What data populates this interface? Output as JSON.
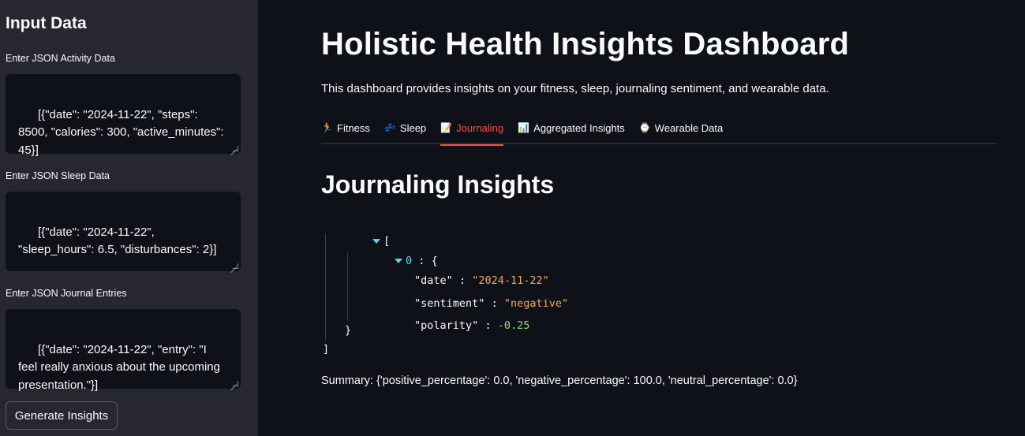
{
  "sidebar": {
    "title": "Input Data",
    "fields": [
      {
        "label": "Enter JSON Activity Data",
        "value": "[{\"date\": \"2024-11-22\", \"steps\": 8500, \"calories\": 300, \"active_minutes\": 45}]"
      },
      {
        "label": "Enter JSON Sleep Data",
        "value": "[{\"date\": \"2024-11-22\", \"sleep_hours\": 6.5, \"disturbances\": 2}]"
      },
      {
        "label": "Enter JSON Journal Entries",
        "value": "[{\"date\": \"2024-11-22\", \"entry\": \"I feel really anxious about the upcoming presentation.\"}]"
      }
    ],
    "button_label": "Generate Insights"
  },
  "main": {
    "title": "Holistic Health Insights Dashboard",
    "description": "This dashboard provides insights on your fitness, sleep, journaling sentiment, and wearable data.",
    "tabs": [
      {
        "label": "Fitness",
        "icon": "running-person-icon",
        "glyph": "🏃"
      },
      {
        "label": "Sleep",
        "icon": "zzz-icon",
        "glyph": "💤"
      },
      {
        "label": "Journaling",
        "icon": "memo-icon",
        "glyph": "📝",
        "active": true
      },
      {
        "label": "Aggregated Insights",
        "icon": "chart-icon",
        "glyph": "📊"
      },
      {
        "label": "Wearable Data",
        "icon": "watch-icon",
        "glyph": "⌚"
      }
    ],
    "section_title": "Journaling Insights",
    "json_view": {
      "open_bracket": "[",
      "index": "0",
      "open_brace": "{",
      "entries": [
        {
          "key": "\"date\"",
          "value": "\"2024-11-22\"",
          "kind": "string"
        },
        {
          "key": "\"sentiment\"",
          "value": "\"negative\"",
          "kind": "string"
        },
        {
          "key": "\"polarity\"",
          "value": "-0.25",
          "kind": "number"
        }
      ],
      "close_brace": "}",
      "close_bracket": "]"
    },
    "summary": "Summary: {'positive_percentage': 0.0, 'negative_percentage': 100.0, 'neutral_percentage': 0.0}"
  },
  "colors": {
    "background": "#0e1117",
    "sidebar": "#262730",
    "accent": "#ff4b4b",
    "json_string": "#f0a860",
    "json_number": "#9cd96f",
    "json_index": "#5fd3e8"
  }
}
